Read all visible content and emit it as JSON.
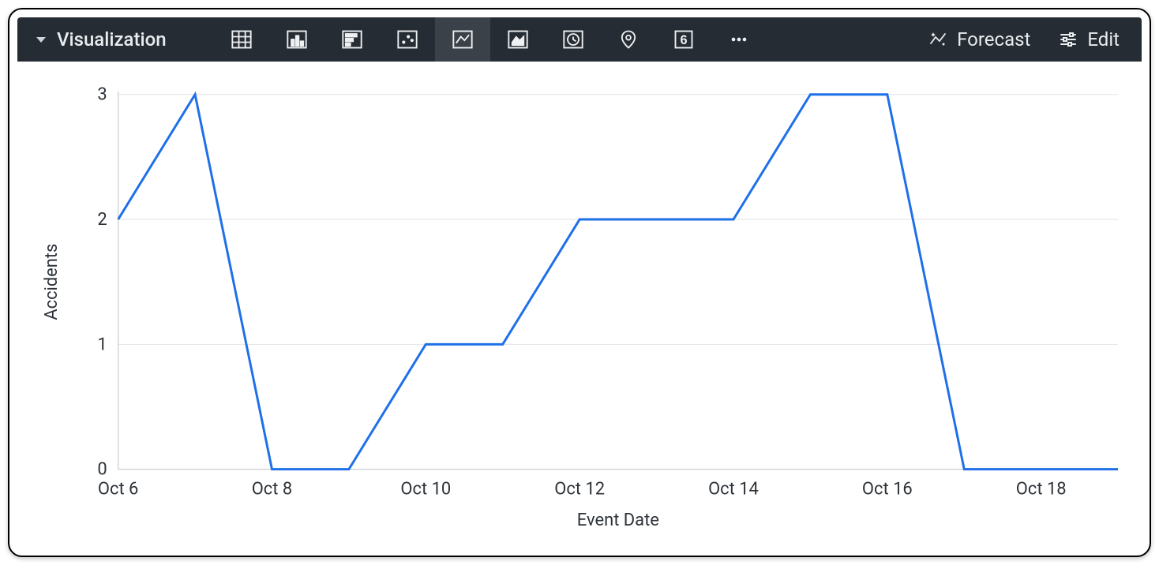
{
  "toolbar": {
    "title": "Visualization",
    "forecast_label": "Forecast",
    "edit_label": "Edit",
    "vis_types": [
      {
        "name": "table",
        "active": false
      },
      {
        "name": "column",
        "active": false
      },
      {
        "name": "bar",
        "active": false
      },
      {
        "name": "scatter",
        "active": false
      },
      {
        "name": "line",
        "active": true
      },
      {
        "name": "area",
        "active": false
      },
      {
        "name": "pie-timeline",
        "active": false
      },
      {
        "name": "map",
        "active": false
      },
      {
        "name": "single-value",
        "active": false
      },
      {
        "name": "more",
        "active": false
      }
    ]
  },
  "chart_data": {
    "type": "line",
    "xlabel": "Event Date",
    "ylabel": "Accidents",
    "ylim": [
      0,
      3
    ],
    "y_ticks": [
      0,
      1,
      2,
      3
    ],
    "x_tick_labels": [
      "Oct 6",
      "Oct 8",
      "Oct 10",
      "Oct 12",
      "Oct 14",
      "Oct 16",
      "Oct 18"
    ],
    "x_tick_indices": [
      0,
      2,
      4,
      6,
      8,
      10,
      12
    ],
    "categories": [
      "Oct 6",
      "Oct 7",
      "Oct 8",
      "Oct 9",
      "Oct 10",
      "Oct 11",
      "Oct 12",
      "Oct 13",
      "Oct 14",
      "Oct 15",
      "Oct 16",
      "Oct 17",
      "Oct 18",
      "Oct 19"
    ],
    "values": [
      2,
      3,
      0,
      0,
      1,
      1,
      2,
      2,
      2,
      3,
      3,
      0,
      0,
      0
    ],
    "line_color": "#1f70e8"
  }
}
